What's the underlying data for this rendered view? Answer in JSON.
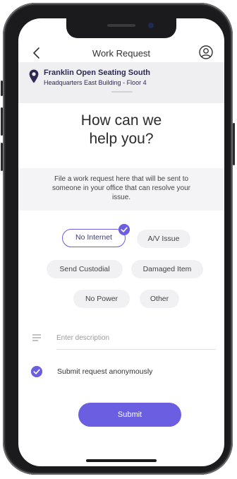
{
  "header": {
    "title": "Work Request",
    "back_icon": "chevron-left-icon",
    "profile_icon": "user-circle-icon"
  },
  "location": {
    "name": "Franklin Open Seating South",
    "subtitle": "Headquarters East Building - Floor 4",
    "icon": "map-pin-icon"
  },
  "headline": {
    "line1": "How can we",
    "line2": "help you?"
  },
  "info": {
    "text": "File a work request here that will be sent to someone in your office that can resolve your issue."
  },
  "issues": [
    {
      "label": "No Internet",
      "selected": true
    },
    {
      "label": "A/V Issue",
      "selected": false
    },
    {
      "label": "Send Custodial",
      "selected": false
    },
    {
      "label": "Damaged Item",
      "selected": false
    },
    {
      "label": "No Power",
      "selected": false
    },
    {
      "label": "Other",
      "selected": false
    }
  ],
  "description": {
    "placeholder": "Enter description",
    "value": "",
    "icon": "text-lines-icon"
  },
  "anonymous": {
    "label": "Submit request anonymously",
    "checked": true
  },
  "submit": {
    "label": "Submit"
  },
  "colors": {
    "accent": "#6b5ee0",
    "location_text": "#2c2a55",
    "location_bg": "#efeff2"
  }
}
